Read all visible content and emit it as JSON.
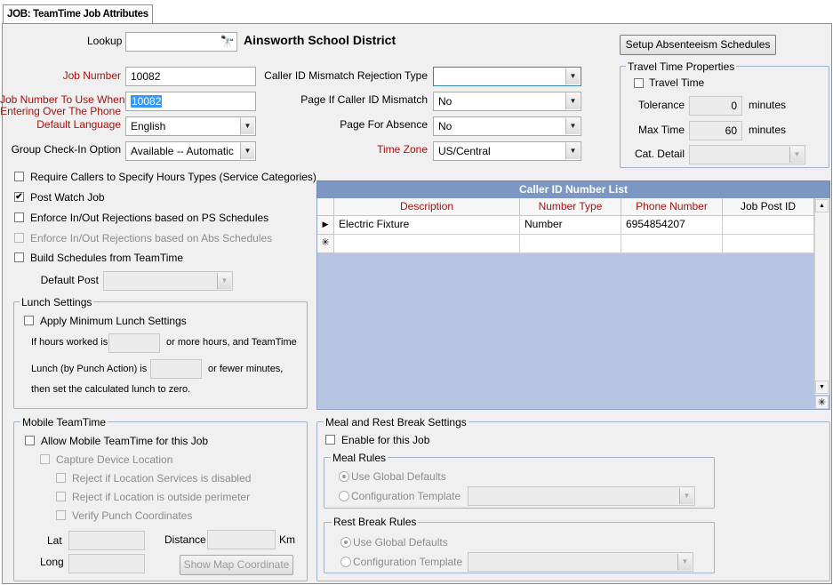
{
  "tab": {
    "label": "JOB: TeamTime Job Attributes"
  },
  "lookup": {
    "label": "Lookup",
    "value": "",
    "district": "Ainsworth School District"
  },
  "job_number": {
    "label": "Job Number",
    "value": "10082"
  },
  "job_number_phone": {
    "label_line1": "Job Number To Use When",
    "label_line2": "Entering Over The Phone",
    "value": "10082"
  },
  "default_language": {
    "label": "Default Language",
    "value": "English"
  },
  "group_checkin": {
    "label": "Group Check-In Option",
    "value": "Available -- Automatic"
  },
  "caller_mismatch_type": {
    "label": "Caller ID Mismatch Rejection Type",
    "value": ""
  },
  "page_caller_mismatch": {
    "label": "Page If Caller ID Mismatch",
    "value": "No"
  },
  "page_absence": {
    "label": "Page For Absence",
    "value": "No"
  },
  "time_zone": {
    "label": "Time Zone",
    "value": "US/Central"
  },
  "setup_button": {
    "label": "Setup Absenteeism Schedules"
  },
  "travel": {
    "title": "Travel Time Properties",
    "travel_time_label": "Travel Time",
    "tolerance_label": "Tolerance",
    "tolerance_value": "0",
    "max_time_label": "Max Time",
    "max_time_value": "60",
    "unit": "minutes",
    "cat_detail_label": "Cat. Detail",
    "cat_detail_value": ""
  },
  "checkboxes": {
    "require_callers": {
      "label": "Require Callers to Specify Hours Types (Service Categories)",
      "checked": false
    },
    "post_watch": {
      "label": "Post Watch Job",
      "checked": true
    },
    "enforce_ps": {
      "label": "Enforce In/Out Rejections based on PS Schedules",
      "checked": false
    },
    "enforce_abs": {
      "label": "Enforce In/Out Rejections based on Abs Schedules",
      "checked": false
    },
    "build_schedules": {
      "label": "Build Schedules from TeamTime",
      "checked": false
    }
  },
  "default_post": {
    "label": "Default Post",
    "value": ""
  },
  "lunch": {
    "title": "Lunch Settings",
    "apply_label": "Apply Minimum Lunch Settings",
    "line1_a": "If hours worked is",
    "line1_b": "or more hours, and TeamTime",
    "line2_a": "Lunch (by Punch Action) is",
    "line2_b": "or fewer minutes,",
    "line3": "then set the calculated lunch to zero.",
    "hours_value": "",
    "minutes_value": ""
  },
  "caller_grid": {
    "title": "Caller ID Number List",
    "columns": [
      "Description",
      "Number Type",
      "Phone Number",
      "Job Post ID"
    ],
    "rows": [
      [
        "Electric Fixture",
        "Number",
        "6954854207",
        ""
      ]
    ],
    "row_marker": "▶",
    "new_row_marker": "✳"
  },
  "mobile": {
    "title": "Mobile TeamTime",
    "allow_label": "Allow Mobile TeamTime for this Job",
    "capture_label": "Capture Device Location",
    "reject_services_label": "Reject if Location Services is disabled",
    "reject_perimeter_label": "Reject if Location is outside perimeter",
    "verify_label": "Verify Punch Coordinates",
    "lat_label": "Lat",
    "long_label": "Long",
    "distance_label": "Distance",
    "distance_unit": "Km",
    "show_map_button": "Show Map Coordinate"
  },
  "meal_rest": {
    "title": "Meal and Rest Break Settings",
    "enable_label": "Enable for this Job",
    "meal_rules_title": "Meal Rules",
    "rest_rules_title": "Rest Break Rules",
    "use_global_label": "Use Global Defaults",
    "config_template_label": "Configuration Template"
  }
}
